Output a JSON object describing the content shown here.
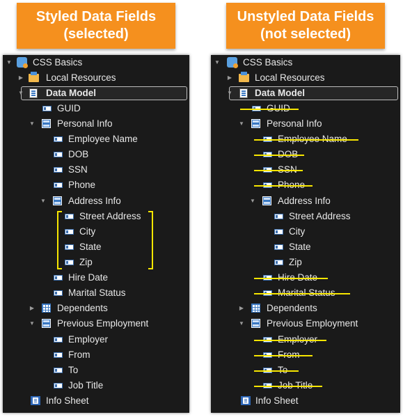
{
  "banners": {
    "left": {
      "line1": "Styled Data Fields",
      "line2": "(selected)"
    },
    "right": {
      "line1": "Unstyled Data Fields",
      "line2": "(not selected)"
    }
  },
  "tree": {
    "css_basics": "CSS Basics",
    "local_resources": "Local Resources",
    "data_model": "Data Model",
    "guid": "GUID",
    "personal_info": "Personal Info",
    "employee_name": "Employee Name",
    "dob": "DOB",
    "ssn": "SSN",
    "phone": "Phone",
    "address_info": "Address Info",
    "street_address": "Street Address",
    "city": "City",
    "state": "State",
    "zip": "Zip",
    "hire_date": "Hire Date",
    "marital_status": "Marital Status",
    "dependents": "Dependents",
    "previous_employment": "Previous Employment",
    "employer": "Employer",
    "from": "From",
    "to": "To",
    "job_title": "Job Title",
    "info_sheet": "Info Sheet"
  },
  "icons": {
    "project": "project-icon",
    "folder": "folder-icon",
    "data_model": "data-model-icon",
    "field": "field-icon",
    "entity": "entity-icon",
    "table": "table-icon",
    "sheet": "sheet-icon"
  },
  "colors": {
    "banner": "#f5901e",
    "panel": "#1a1a1a",
    "highlight": "#f7e600"
  }
}
